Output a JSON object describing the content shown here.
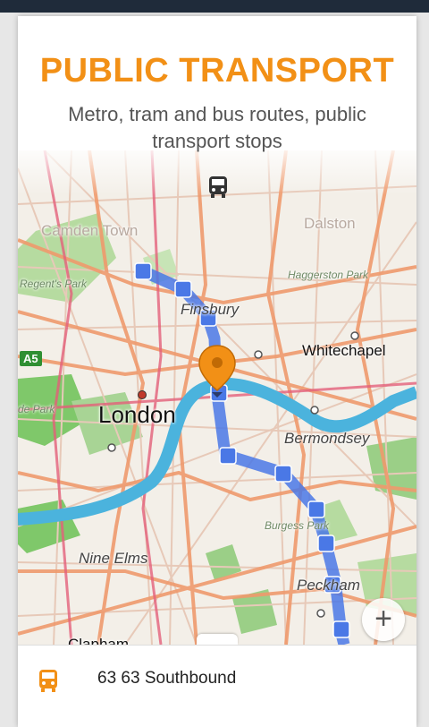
{
  "header": {
    "title": "PUBLIC TRANSPORT",
    "subtitle": "Metro, tram and bus routes, public transport stops",
    "mode_icon": "bus-icon"
  },
  "map": {
    "labels": {
      "camden": "Camden Town",
      "dalston": "Dalston",
      "regents": "Regent's Park",
      "haggerston": "Haggerston Park",
      "finsbury": "Finsbury",
      "whitechapel": "Whitechapel",
      "london": "London",
      "park": "de Park",
      "bermondsey": "Bermondsey",
      "burgess": "Burgess Park",
      "nine_elms": "Nine Elms",
      "peckham": "Peckham",
      "clapham": "Clapham"
    },
    "road_shield": "A5",
    "zoom_in_label": "+",
    "colors": {
      "route": "#4a78e6",
      "river": "#4bb3dd",
      "pin": "#f29016"
    }
  },
  "sheet": {
    "route_icon": "bus-icon",
    "route_label": "63 63 Southbound",
    "accent": "#f29016"
  }
}
